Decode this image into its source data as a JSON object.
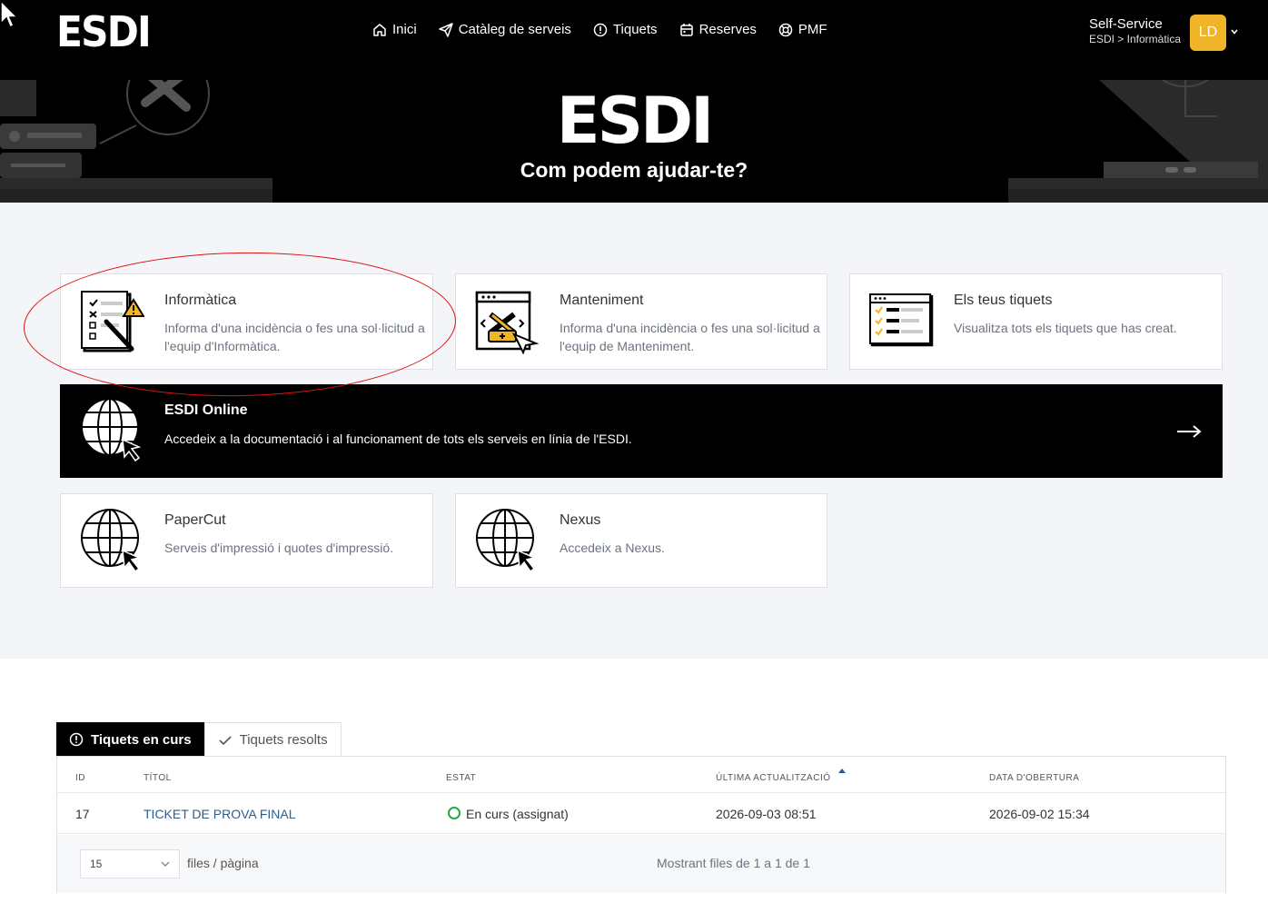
{
  "header": {
    "logo": "ESDI",
    "nav": [
      {
        "label": "Inici",
        "icon": "home-icon"
      },
      {
        "label": "Catàleg de serveis",
        "icon": "paper-plane-icon"
      },
      {
        "label": "Tiquets",
        "icon": "alert-circle-icon"
      },
      {
        "label": "Reserves",
        "icon": "calendar-icon"
      },
      {
        "label": "PMF",
        "icon": "lifebuoy-icon"
      }
    ],
    "user": {
      "name": "Self-Service",
      "path": "ESDI > Informàtica",
      "initials": "LD"
    }
  },
  "hero": {
    "title": "ESDI",
    "subtitle": "Com podem ajudar-te?"
  },
  "cards": {
    "informatica": {
      "title": "Informàtica",
      "desc": "Informa d'una incidència o fes una sol·licitud a l'equip d'Informàtica.",
      "icon": "checklist-warning-icon"
    },
    "manteniment": {
      "title": "Manteniment",
      "desc": "Informa d'una incidència o fes una sol·licitud a l'equip de Manteniment.",
      "icon": "tools-window-icon"
    },
    "tiquets": {
      "title": "Els teus tiquets",
      "desc": "Visualitza tots els tiquets que has creat.",
      "icon": "ticket-list-icon"
    },
    "online": {
      "title": "ESDI Online",
      "desc": "Accedeix a la documentació i al funcionament de tots els serveis en línia de l'ESDI.",
      "icon": "globe-cursor-icon"
    },
    "papercut": {
      "title": "PaperCut",
      "desc": "Serveis d'impressió i quotes d'impressió.",
      "icon": "globe-cursor-icon"
    },
    "nexus": {
      "title": "Nexus",
      "desc": "Accedeix a Nexus.",
      "icon": "globe-cursor-icon"
    }
  },
  "tabs": {
    "active": "Tiquets en curs",
    "inactive": "Tiquets resolts"
  },
  "table": {
    "columns": [
      "ID",
      "TÍTOL",
      "ESTAT",
      "ÚLTIMA ACTUALITZACIÓ",
      "DATA D'OBERTURA"
    ],
    "rows": [
      {
        "id": "17",
        "title": "TICKET DE PROVA FINAL",
        "status": "En curs (assignat)",
        "updated": "2026-09-03 08:51",
        "opened": "2026-09-02 15:34"
      }
    ],
    "page_size": "15",
    "per_page_label": "files / pàgina",
    "showing": "Mostrant files de 1 a 1 de 1"
  },
  "colors": {
    "accent": "#f0b429",
    "status_ok": "#22aa44",
    "link": "#2f5d8a"
  }
}
